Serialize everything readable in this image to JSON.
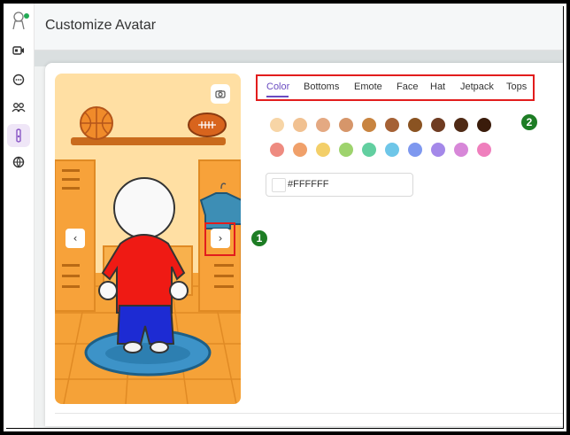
{
  "header": {
    "title": "Customize Avatar"
  },
  "sidebar": {
    "items": [
      {
        "icon": "video-camera-icon"
      },
      {
        "icon": "chat-icon"
      },
      {
        "icon": "people-icon"
      },
      {
        "icon": "wardrobe-icon",
        "active": true
      },
      {
        "icon": "globe-icon"
      }
    ]
  },
  "tabs": [
    "Color",
    "Bottoms",
    "Emote",
    "Face",
    "Hat",
    "Jetpack",
    "Tops"
  ],
  "active_tab": "Color",
  "swatches": {
    "row1": [
      "#f7d5a6",
      "#f1c191",
      "#e4a982",
      "#d6966a",
      "#c88440",
      "#a56135",
      "#8a5322",
      "#6f3c22",
      "#4f2a15",
      "#3a1c0b"
    ],
    "row2": [
      "#ee8b80",
      "#f0a06a",
      "#f3cf69",
      "#9ed36d",
      "#62cfa0",
      "#6ec6e8",
      "#7e98ef",
      "#a488e9",
      "#d787d8",
      "#ef7fbd"
    ]
  },
  "color_input": {
    "value": "#FFFFFF"
  },
  "annotations": {
    "marker_1": "1",
    "marker_2": "2"
  },
  "colors": {
    "accent": "#6a4cc1",
    "highlight": "#e21d1d",
    "marker": "#1d7d24"
  }
}
